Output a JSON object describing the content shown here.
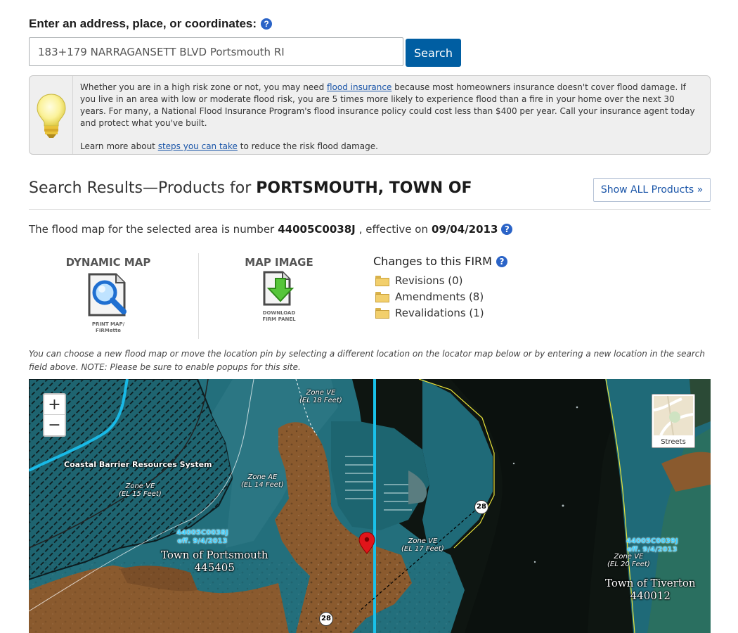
{
  "search": {
    "label": "Enter an address, place, or coordinates:",
    "value": "183+179 NARRAGANSETT BLVD Portsmouth RI",
    "button": "Search"
  },
  "info": {
    "text_before_link": "Whether you are in a high risk zone or not, you may need ",
    "link": "flood insurance",
    "text_after_link": " because most homeowners insurance doesn't cover flood damage. If you live in an area with low or moderate flood risk, you are 5 times more likely to experience flood than a fire in your home over the next 30 years. For many, a National Flood Insurance Program's flood insurance policy could cost less than $400 per year. Call your insurance agent today and protect what you've built.",
    "learn_before": "Learn more about ",
    "learn_link": "steps you can take",
    "learn_after": " to reduce the risk flood damage."
  },
  "results": {
    "heading_prefix": "Search Results—Products for ",
    "community": "PORTSMOUTH, TOWN OF",
    "show_all": "Show ALL Products »"
  },
  "panel": {
    "prefix": "The flood map for the selected area is number ",
    "number": "44005C0038J",
    "middle": ", effective on ",
    "date": "09/04/2013"
  },
  "products": {
    "dynamic_title": "DYNAMIC MAP",
    "dynamic_sub1": "PRINT MAP/",
    "dynamic_sub2": "FIRMette",
    "image_title": "MAP IMAGE",
    "image_sub1": "DOWNLOAD",
    "image_sub2": "FIRM PANEL"
  },
  "changes": {
    "title": "Changes to this FIRM",
    "items": [
      {
        "label": "Revisions (0)"
      },
      {
        "label": "Amendments (8)"
      },
      {
        "label": "Revalidations (1)"
      }
    ]
  },
  "note": "You can choose a new flood map or move the location pin by selecting a different location on the locator map below or by entering a new location in the search field above. NOTE: Please be sure to enable popups for this site.",
  "map": {
    "zoom_in": "+",
    "zoom_out": "−",
    "basemap_label": "Streets",
    "crs_label": "Coastal Barrier Resources System",
    "zone_ve_top": "Zone VE",
    "zone_ve_top_el": "(EL 18 Feet)",
    "zone_ve_left": "Zone VE",
    "zone_ve_left_el": "(EL 15 Feet)",
    "zone_ae": "Zone AE",
    "zone_ae_el": "(EL 14 Feet)",
    "zone_ve_mid": "Zone VE",
    "zone_ve_mid_el": "(EL 17 Feet)",
    "zone_ve_right": "Zone VE",
    "zone_ve_right_el": "(EL 20 Feet)",
    "panel_left_num": "44005C0038J",
    "panel_left_date": "eff. 9/4/2013",
    "panel_right_num": "44005C0039J",
    "panel_right_date": "eff. 9/4/2013",
    "town_left": "Town of Portsmouth",
    "town_left_id": "445405",
    "town_right": "Town of Tiverton",
    "town_right_id": "440012",
    "route_a": "28",
    "route_b": "28"
  },
  "colors": {
    "primary": "#005ea2",
    "link": "#1a55a8",
    "flood_zone": "#1f6a78",
    "land": "#8a5a2e",
    "water": "#0f1612",
    "boundary": "#1fc2ea"
  }
}
